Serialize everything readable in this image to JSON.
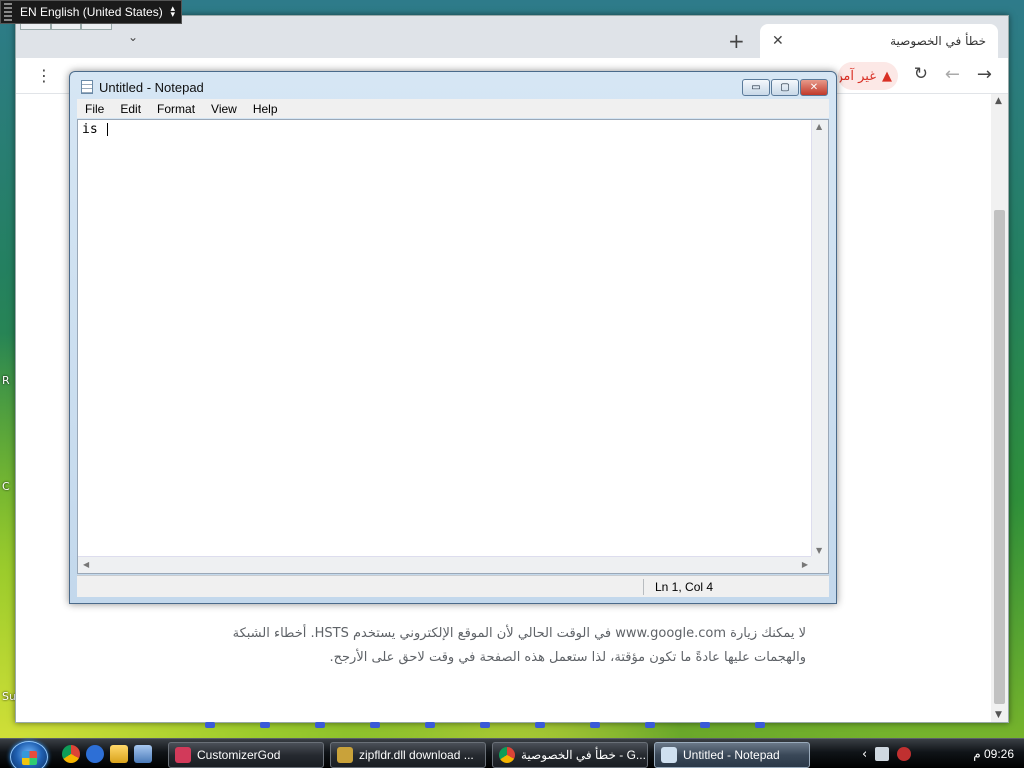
{
  "language_bar": {
    "text": "EN English (United States)"
  },
  "desktop": {
    "edge_labels": [
      "R",
      "C",
      "Su"
    ]
  },
  "browser": {
    "tab_title": "خطأ في الخصوصية",
    "tab_close": "✕",
    "new_tab": "+",
    "tab_list": "⌄",
    "menu_icon": "⋮",
    "back": "←",
    "forward": "→",
    "reload": "↻",
    "security_warning": "غير آمن",
    "page_text": "لا يمكنك زيارة www.google.com في الوقت الحالي لأن الموقع الإلكتروني يستخدم HSTS. أخطاء الشبكة والهجمات عليها عادةً ما تكون مؤقتة، لذا ستعمل هذه الصفحة في وقت لاحق على الأرجح."
  },
  "notepad": {
    "title": "Untitled - Notepad",
    "menu": [
      "File",
      "Edit",
      "Format",
      "View",
      "Help"
    ],
    "content": "is ",
    "status_position": "Ln 1, Col 4",
    "buttons": {
      "minimize": "▭",
      "maximize": "▢",
      "close": "✕"
    }
  },
  "taskbar": {
    "tasks": [
      {
        "label": "CustomizerGod",
        "icon_color": "#d23a5a"
      },
      {
        "label": "zipfldr.dll download ...",
        "icon_color": "#c9a23a"
      },
      {
        "label": "خطأ في الخصوصية - G...",
        "icon_color": "#db4437"
      },
      {
        "label": "Untitled - Notepad",
        "icon_color": "#cfe0f0"
      }
    ],
    "active_task": "Untitled - Notepad",
    "clock": "09:26 م",
    "tray_chevron": "‹"
  },
  "colors": {
    "warning_red": "#d93025",
    "taskbar_dark": "#101418",
    "vista_glass": "#c3d8ec"
  }
}
